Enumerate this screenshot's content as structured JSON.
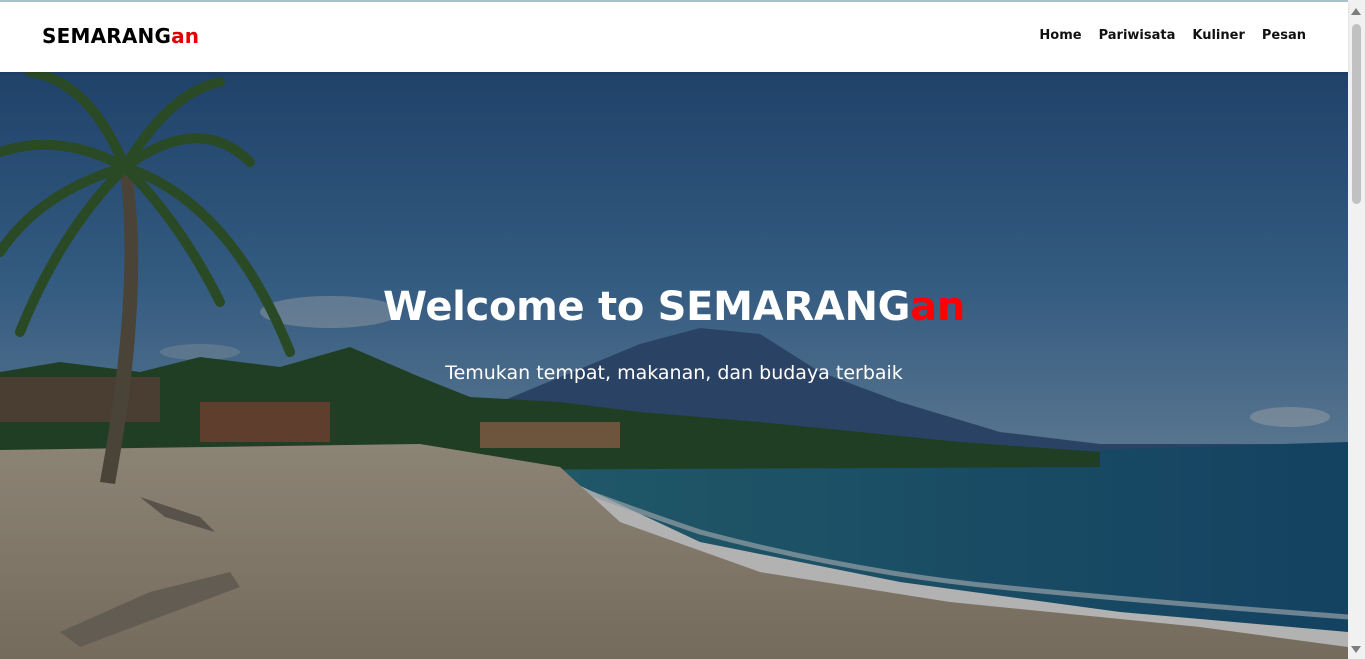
{
  "brand": {
    "prefix": "SEMARANG",
    "suffix": "an"
  },
  "nav": {
    "home": "Home",
    "pariwisata": "Pariwisata",
    "kuliner": "Kuliner",
    "pesan": "Pesan"
  },
  "hero": {
    "title_prefix": "Welcome to SEMARANG",
    "title_suffix": "an",
    "subtitle": "Temukan tempat, makanan, dan budaya terbaik"
  },
  "colors": {
    "accent": "#e30000",
    "overlay": "rgba(0,0,0,0.30)"
  },
  "icons": {
    "scroll_up": "scroll-up-arrow-icon",
    "scroll_down": "scroll-down-arrow-icon"
  }
}
